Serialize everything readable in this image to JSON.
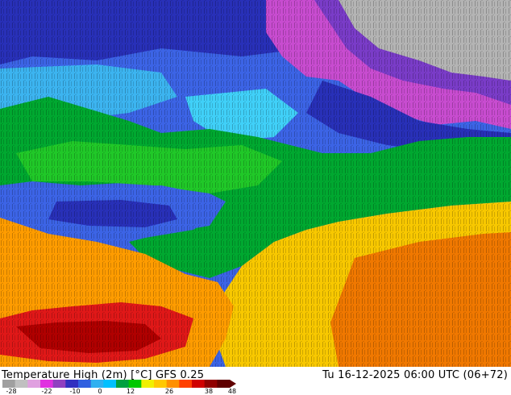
{
  "map": {
    "title": "Temperature High (2m) [°C] GFS 0.25",
    "valid_time": "Tu 16-12-2025 06:00 UTC (06+72)"
  },
  "legend": {
    "tick_labels": [
      "-28",
      "-22",
      "-10",
      "0",
      "12",
      "26",
      "38",
      "48"
    ],
    "palette": [
      "#a0a0a0",
      "#c0c0c0",
      "#e0a0e0",
      "#e030e0",
      "#9040c0",
      "#3030c0",
      "#3060e0",
      "#30b0f0",
      "#00c0ff",
      "#00a040",
      "#00c800",
      "#f0f000",
      "#ffc800",
      "#ff9000",
      "#ff4000",
      "#d00000",
      "#900000",
      "#600000"
    ]
  },
  "colors": {
    "deep_purple": "#7a3cc8",
    "magenta": "#c84cd0",
    "gray": "#b4b4b4",
    "dark_blue": "#2830b8",
    "blue": "#3c64e6",
    "light_blue": "#3cb4f0",
    "cyan": "#40d0f8",
    "green": "#00a830",
    "bright_green": "#20c828",
    "yellow": "#f8c800",
    "orange": "#ff9c00",
    "dark_orange": "#f07800",
    "red": "#e01818",
    "dark_red": "#b00000"
  }
}
